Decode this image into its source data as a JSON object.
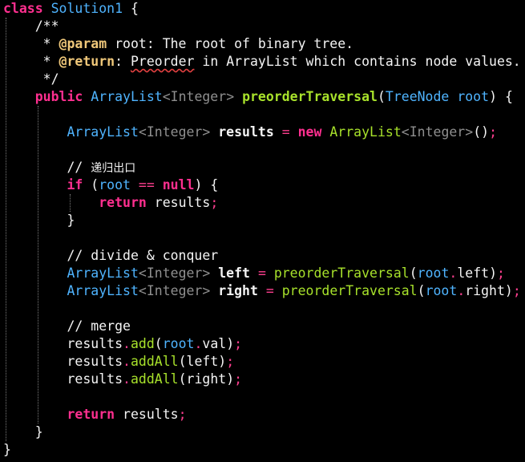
{
  "code": {
    "class_kw": "class",
    "class_name": "Solution1",
    "brace_open": "{",
    "brace_close": "}",
    "doc_open": "/**",
    "doc_star": "*",
    "doc_param_tag": "@param",
    "doc_param_text": " root: The root of binary tree.",
    "doc_return_tag": "@return",
    "doc_return_colon": ": ",
    "doc_return_word": "Preorder",
    "doc_return_rest": " in ArrayList which contains node values.",
    "doc_close": "*/",
    "public_kw": "public",
    "new_kw": "new",
    "if_kw": "if",
    "null_kw": "null",
    "return_kw": "return",
    "arraylist": "ArrayList",
    "lt": "<",
    "gt": ">",
    "integer": "Integer",
    "method_name": "preorderTraversal",
    "param_type": "TreeNode",
    "root": "root",
    "results": "results",
    "left": "left",
    "right": "right",
    "val": "val",
    "add": "add",
    "addAll": "addAll",
    "dot": ".",
    "eq": "=",
    "eqeq": "==",
    "semi": ";",
    "lparen": "(",
    "rparen": ")",
    "empty_parens": "()",
    "comment_slash": "// ",
    "comment_exit": "递归出口",
    "comment_divide": "// divide & conquer",
    "comment_merge": "// merge"
  }
}
